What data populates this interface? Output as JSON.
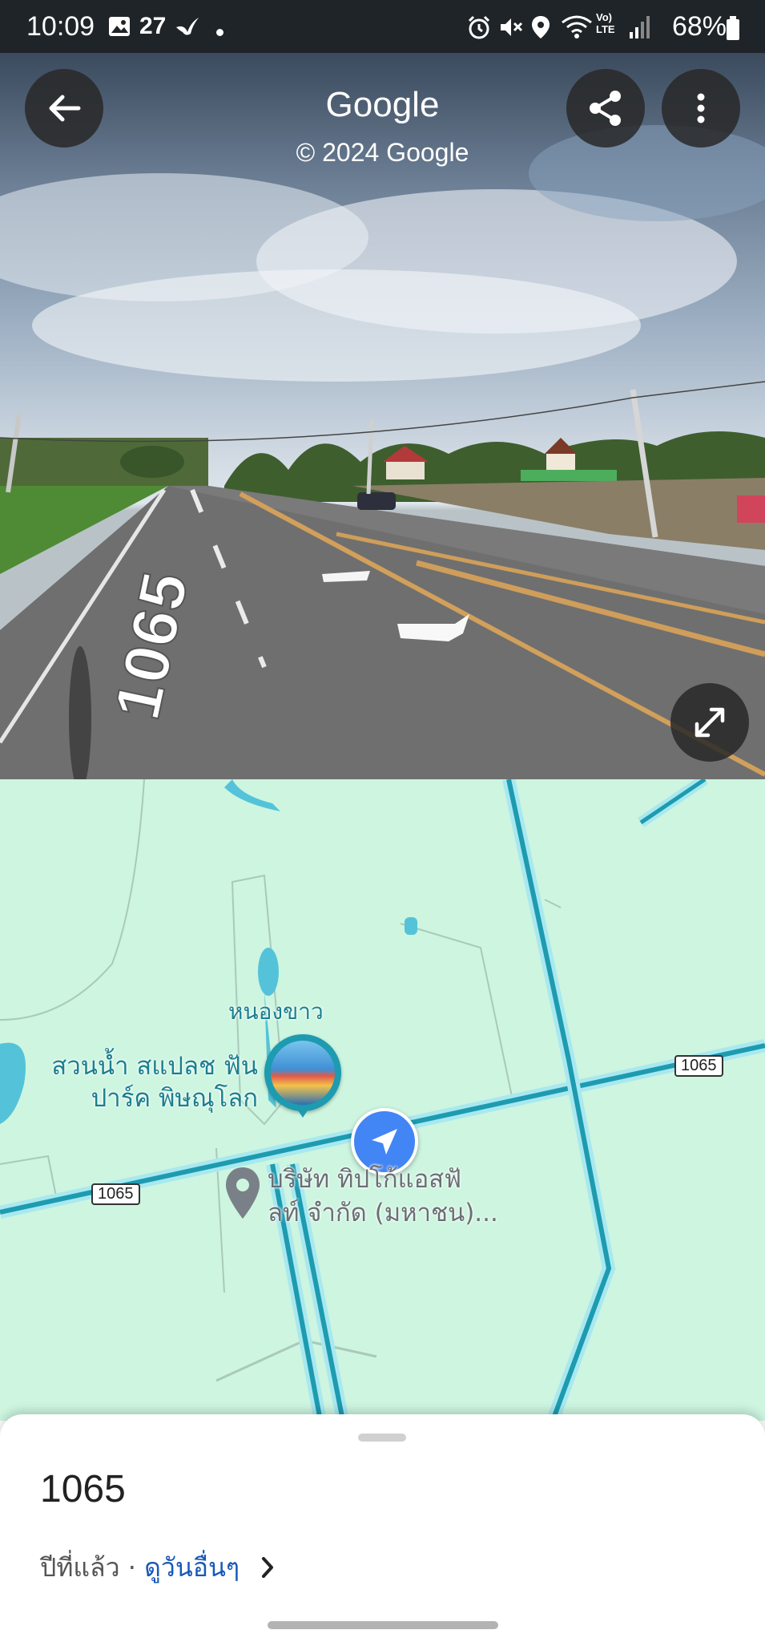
{
  "status_bar": {
    "time": "10:09",
    "notification_count": "27",
    "battery": "68%"
  },
  "street_view": {
    "title": "Google",
    "copyright": "© 2024 Google",
    "road_marking": "1065"
  },
  "map": {
    "labels": {
      "pond": "หนองขาว",
      "water_park": "สวนน้ำ สแปลช ฟัน\nปาร์ค พิษณุโลก",
      "company": "บริษัท ทิปโก้แอสฟั\nลท์ จำกัด (มหาชน)..."
    },
    "shields": [
      "1065",
      "1065"
    ],
    "colors": {
      "land": "#cdf5e0",
      "road": "#1d9bb0",
      "location": "#4285f4"
    }
  },
  "bottom_sheet": {
    "title": "1065",
    "subtitle_prefix": "ปีที่แล้ว · ",
    "subtitle_link": "ดูวันอื่นๆ"
  },
  "icons": [
    "back-arrow-icon",
    "share-icon",
    "more-vert-icon",
    "expand-icon",
    "chevron-right-icon",
    "navigation-arrow-icon",
    "place-pin-icon"
  ]
}
